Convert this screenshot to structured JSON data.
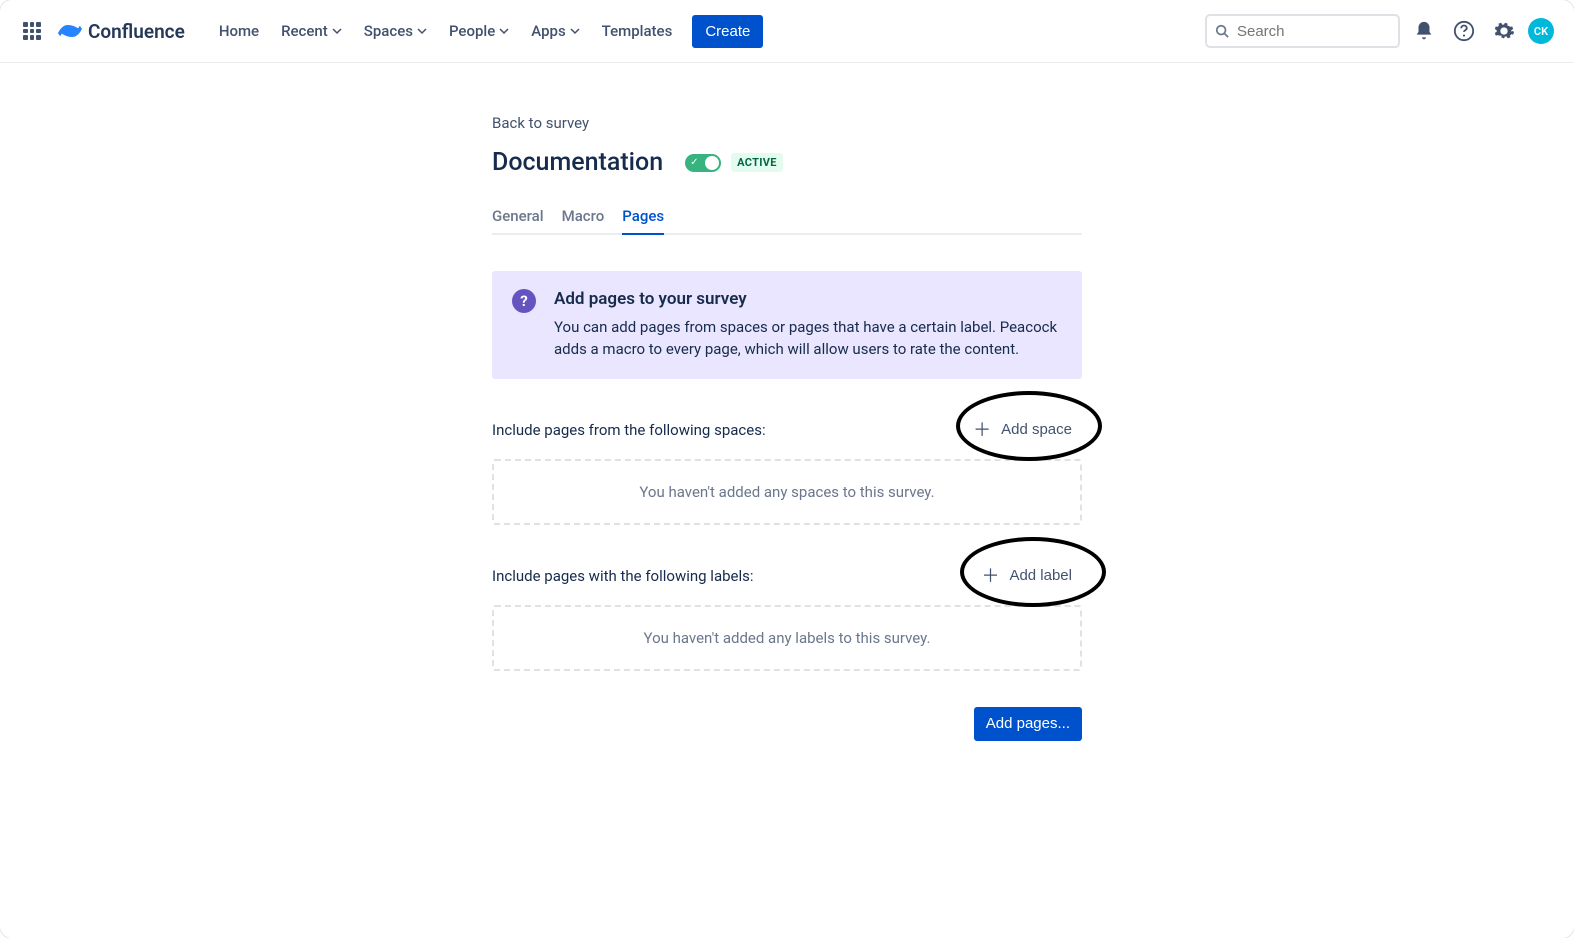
{
  "nav": {
    "product": "Confluence",
    "items": [
      "Home",
      "Recent",
      "Spaces",
      "People",
      "Apps",
      "Templates"
    ],
    "create": "Create",
    "search_placeholder": "Search",
    "avatar_initials": "CK"
  },
  "page": {
    "back_link": "Back to survey",
    "title": "Documentation",
    "status": "ACTIVE",
    "tabs": [
      "General",
      "Macro",
      "Pages"
    ],
    "active_tab": 2,
    "info": {
      "title": "Add pages to your survey",
      "body": "You can add pages from spaces or pages that have a certain label. Peacock adds a macro to every page, which will allow users to rate the content."
    },
    "spaces": {
      "label": "Include pages from the following spaces:",
      "add_button": "Add space",
      "empty": "You haven't added any spaces to this survey."
    },
    "labels": {
      "label": "Include pages with the following labels:",
      "add_button": "Add label",
      "empty": "You haven't added any labels to this survey."
    },
    "submit": "Add pages..."
  }
}
